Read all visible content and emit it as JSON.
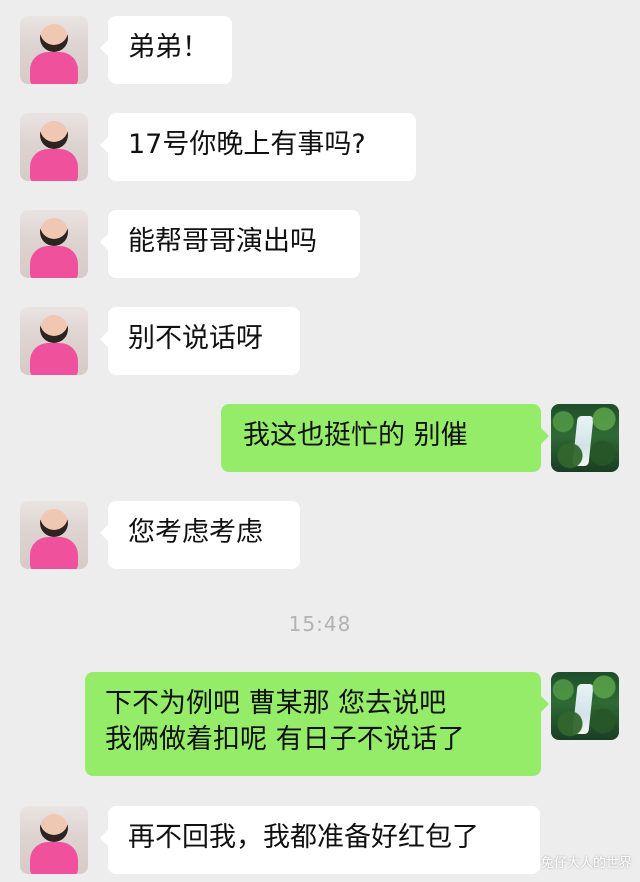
{
  "messages": [
    {
      "side": "left",
      "text": "弟弟！"
    },
    {
      "side": "left",
      "text": "17号你晚上有事吗?"
    },
    {
      "side": "left",
      "text": "能帮哥哥演出吗"
    },
    {
      "side": "left",
      "text": "别不说话呀"
    },
    {
      "side": "right",
      "text": "我这也挺忙的   别催"
    },
    {
      "side": "left",
      "text": "您考虑考虑"
    },
    {
      "side": "right",
      "lines": [
        "下不为例吧   曹某那 您去说吧",
        "我俩做着扣呢 有日子不说话了"
      ]
    },
    {
      "side": "left",
      "text": "再不回我，我都准备好红包了"
    }
  ],
  "time_separator": "15:48",
  "watermark": "兔仔大人的世界",
  "colors": {
    "background": "#ededed",
    "incoming_bubble": "#ffffff",
    "outgoing_bubble": "#95ec69",
    "timestamp": "#b2b2b2"
  },
  "avatars": {
    "incoming": "portrait-avatar",
    "outgoing": "waterfall-avatar"
  }
}
